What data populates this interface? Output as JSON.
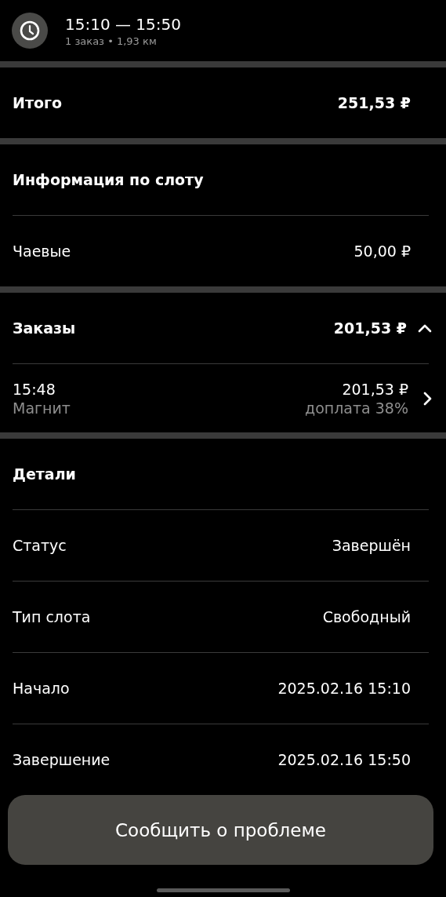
{
  "header": {
    "time_range": "15:10 — 15:50",
    "summary": "1 заказ • 1,93 км"
  },
  "total": {
    "label": "Итого",
    "value": "251,53 ₽"
  },
  "slot_info": {
    "title": "Информация по слоту",
    "rows": [
      {
        "label": "Чаевые",
        "value": "50,00 ₽"
      }
    ]
  },
  "orders": {
    "title": "Заказы",
    "total": "201,53 ₽",
    "expanded": true,
    "items": [
      {
        "time": "15:48",
        "store": "Магнит",
        "amount": "201,53 ₽",
        "note": "доплата 38%"
      }
    ]
  },
  "details": {
    "title": "Детали",
    "rows": [
      {
        "label": "Статус",
        "value": "Завершён"
      },
      {
        "label": "Тип слота",
        "value": "Свободный"
      },
      {
        "label": "Начало",
        "value": "2025.02.16 15:10"
      },
      {
        "label": "Завершение",
        "value": "2025.02.16 15:50"
      }
    ]
  },
  "report_button": {
    "label": "Сообщить о проблеме"
  }
}
